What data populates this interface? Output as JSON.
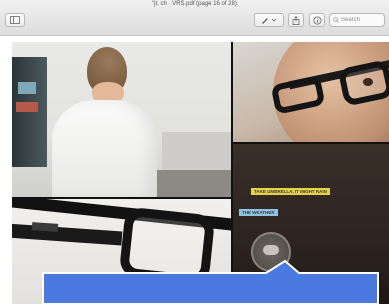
{
  "window": {
    "title": "“jt, ch · VRS.pdf (page 16 of 28)"
  },
  "toolbar": {
    "sidebar_icon": "sidebar-icon",
    "annotate_icon": "pencil-icon",
    "share_icon": "share-icon",
    "info_icon": "info-icon",
    "search_placeholder": "Search"
  },
  "page": {
    "overlay_labels": [
      "TAKE UMBRELLA, IT MIGHT RAIN",
      "THE WEATHER"
    ]
  },
  "colors": {
    "callout_fill": "#4a7ae0",
    "callout_border": "#ffffff",
    "overlay_yellow": "#e3d24a",
    "overlay_blue": "#8fc3e6"
  }
}
